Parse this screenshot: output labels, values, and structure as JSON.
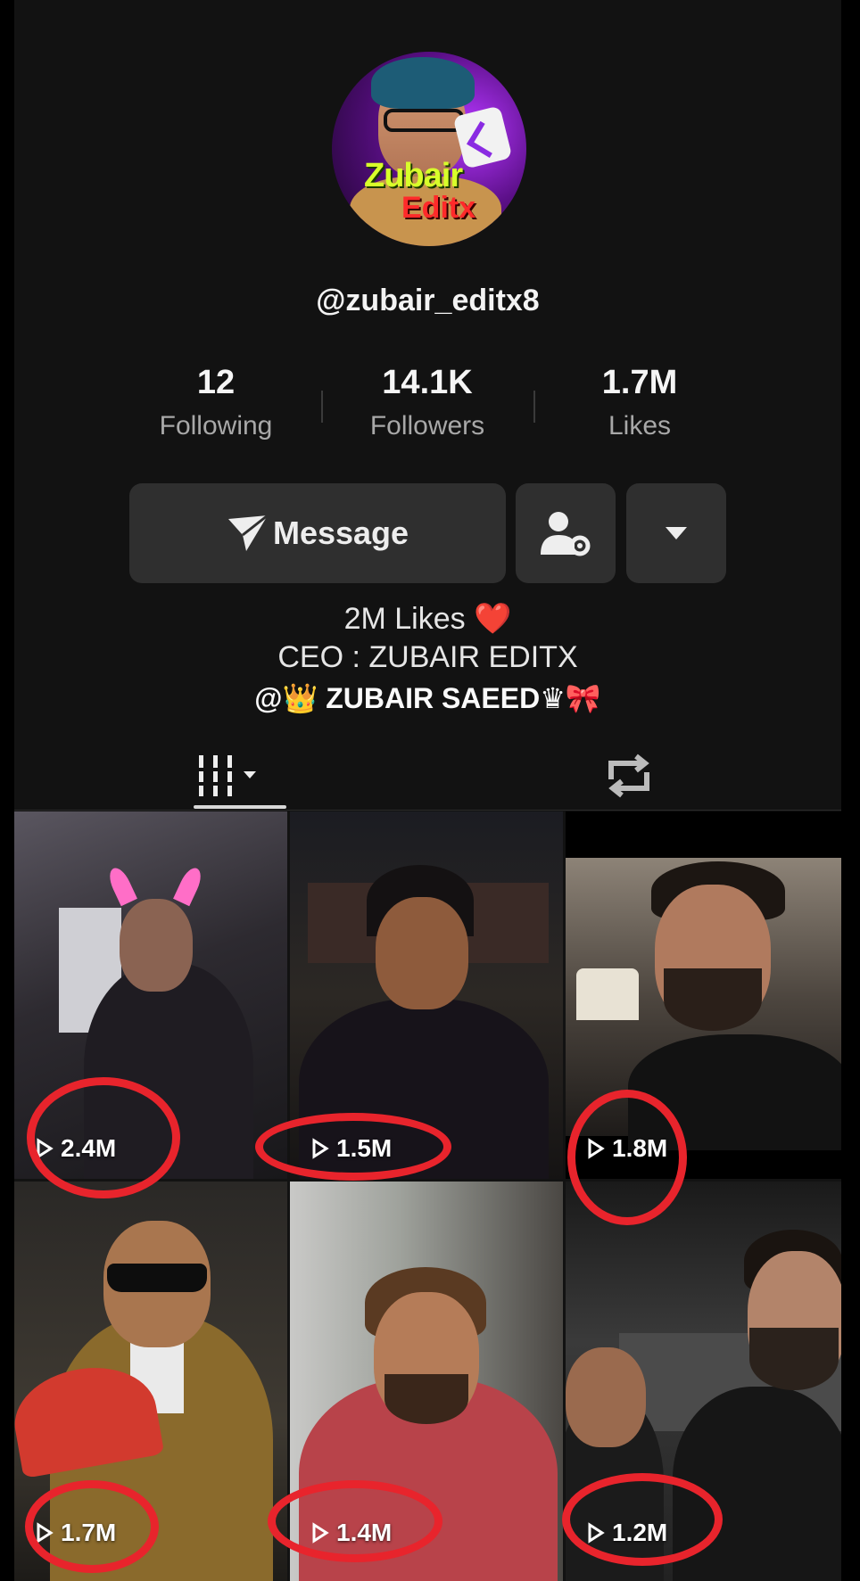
{
  "profile": {
    "username": "@zubair_editx8",
    "avatar_logo_top": "Zubair",
    "avatar_logo_bottom": "Editx"
  },
  "stats": [
    {
      "value": "12",
      "label": "Following"
    },
    {
      "value": "14.1K",
      "label": "Followers"
    },
    {
      "value": "1.7M",
      "label": "Likes"
    }
  ],
  "actions": {
    "message_label": "Message",
    "message_icon": "paper-plane-icon",
    "follow_icon": "person-gear-icon",
    "more_icon": "caret-down-icon"
  },
  "bio": {
    "line1": "2M Likes ❤️",
    "line2": "CEO : ZUBAIR EDITX",
    "line3": "@👑 ZUBAIR SAEED♛🎀"
  },
  "tabs": {
    "videos_icon": "grid-icon",
    "reposts_icon": "repost-icon"
  },
  "videos": [
    {
      "views": "2.4M"
    },
    {
      "views": "1.5M"
    },
    {
      "views": "1.8M"
    },
    {
      "views": "1.7M"
    },
    {
      "views": "1.4M"
    },
    {
      "views": "1.2M"
    }
  ],
  "colors": {
    "background": "#121212",
    "button": "#2f2f2f",
    "highlight_ring": "#e8242c"
  }
}
